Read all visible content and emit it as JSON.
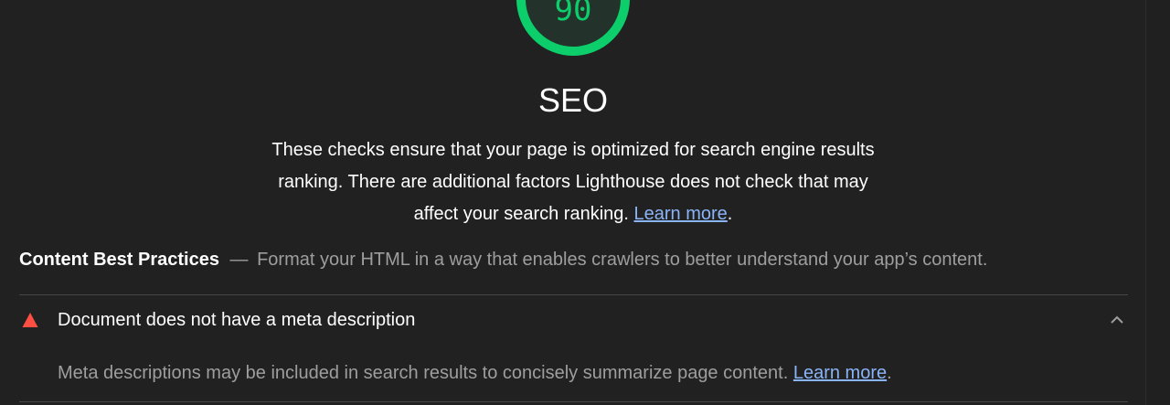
{
  "category": {
    "score": "90",
    "score_fraction": 0.9,
    "score_color": "#0cce6b",
    "title": "SEO",
    "description": "These checks ensure that your page is optimized for search engine results ranking. There are additional factors Lighthouse does not check that may affect your search ranking.",
    "description_line1": "These checks ensure that your page is optimized for search engine results",
    "description_line2": "ranking. There are additional factors Lighthouse does not check that may",
    "description_line3": "affect your search ranking.",
    "learn_more": "Learn more",
    "period": "."
  },
  "group": {
    "title": "Content Best Practices",
    "separator": "—",
    "description": "Format your HTML in a way that enables crawlers to better understand your app’s content."
  },
  "audit": {
    "status_icon": "fail-triangle-icon",
    "status_color": "#ff4e42",
    "title": "Document does not have a meta description",
    "expanded": true,
    "toggle_icon": "chevron-up-icon",
    "description": "Meta descriptions may be included in search results to concisely summarize page content.",
    "learn_more": "Learn more",
    "period": "."
  }
}
